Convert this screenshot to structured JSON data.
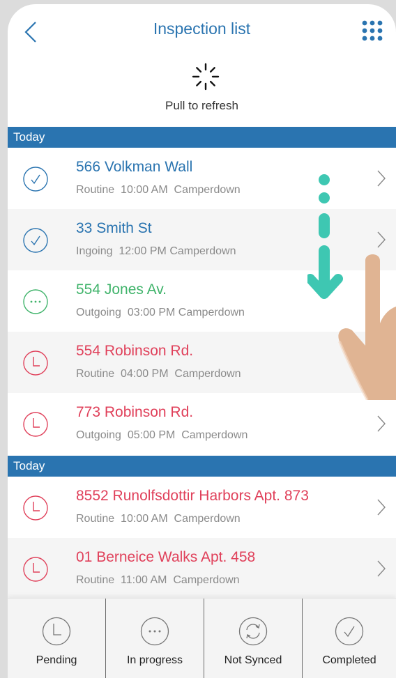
{
  "header": {
    "title": "Inspection list",
    "back_icon": "chevron-left-icon",
    "menu_icon": "grid-dots-icon"
  },
  "refresh": {
    "label": "Pull to refresh",
    "icon": "spinner-icon"
  },
  "sections": [
    {
      "label": "Today",
      "items": [
        {
          "title": "566 Volkman Wall",
          "type": "Routine",
          "time": "10:00 AM",
          "place": "Camperdown",
          "status": "completed"
        },
        {
          "title": "33 Smith St",
          "type": "Ingoing",
          "time": "12:00 PM",
          "place": "Camperdown",
          "status": "completed"
        },
        {
          "title": "554 Jones Av.",
          "type": "Outgoing",
          "time": "03:00 PM",
          "place": "Camperdown",
          "status": "in-progress"
        },
        {
          "title": "554 Robinson Rd.",
          "type": "Routine",
          "time": "04:00 PM",
          "place": "Camperdown",
          "status": "pending"
        },
        {
          "title": "773 Robinson Rd.",
          "type": "Outgoing",
          "time": "05:00 PM",
          "place": "Camperdown",
          "status": "pending"
        }
      ]
    },
    {
      "label": "Today",
      "items": [
        {
          "title": "8552 Runolfsdottir Harbors Apt. 873",
          "type": "Routine",
          "time": "10:00 AM",
          "place": "Camperdown",
          "status": "pending"
        },
        {
          "title": "01 Berneice Walks Apt. 458",
          "type": "Routine",
          "time": "11:00 AM",
          "place": "Camperdown",
          "status": "pending"
        }
      ]
    }
  ],
  "tabs": [
    {
      "label": "Pending",
      "icon": "clock-icon"
    },
    {
      "label": "In progress",
      "icon": "ellipsis-icon"
    },
    {
      "label": "Not Synced",
      "icon": "sync-icon"
    },
    {
      "label": "Completed",
      "icon": "check-icon"
    }
  ],
  "colors": {
    "brand": "#2a74b0",
    "completed": "#2a74b0",
    "in_progress": "#3fb36a",
    "pending": "#e0405a",
    "gesture_arrow": "#3ec7b2",
    "hand": "#e0b493"
  }
}
